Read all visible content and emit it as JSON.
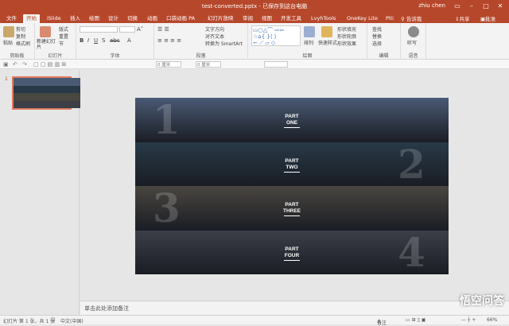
{
  "window": {
    "title": "test-converted.pptx - 已保存到这台电脑",
    "user": "zhiu chen"
  },
  "tabs": [
    "文件",
    "开始",
    "iSlide",
    "插入",
    "绘图",
    "设计",
    "切换",
    "动画",
    "口袋动画 PA",
    "幻灯片放映",
    "审阅",
    "视图",
    "开发工具",
    "LvyhTools",
    "OneKey Lite",
    "Piti"
  ],
  "tabs_right": {
    "search": "告诉我",
    "share": "共享",
    "approve": "批准"
  },
  "ribbon": {
    "clipboard": {
      "label": "剪贴板",
      "paste": "粘贴",
      "cut": "剪切",
      "copy": "复制",
      "format": "格式刷"
    },
    "slides": {
      "label": "幻灯片",
      "new_slide": "新建幻灯片",
      "layout": "版式",
      "reset": "重置",
      "section": "节"
    },
    "font": {
      "label": "字体"
    },
    "paragraph": {
      "label": "段落",
      "text_direction": "文字方向",
      "align_text": "对齐文本",
      "smartart": "转换为 SmartArt"
    },
    "drawing": {
      "label": "绘图",
      "arrange": "排列",
      "quick_styles": "快速样式",
      "fill": "形状填充",
      "outline": "形状轮廓",
      "effect": "形状效果"
    },
    "editing": {
      "label": "编辑",
      "find": "查找",
      "replace": "替换",
      "select": "选择"
    },
    "voice": {
      "label": "语音",
      "dictate": "听写"
    }
  },
  "qat": {
    "field1": "0 厘米",
    "field2": "0 厘米"
  },
  "thumbnail": {
    "number": "1"
  },
  "slide": {
    "bands": [
      {
        "number": "1",
        "part": "PART",
        "name": "ONE",
        "bg": "#4a5a74"
      },
      {
        "number": "2",
        "part": "PART",
        "name": "TWO",
        "bg": "#283a48"
      },
      {
        "number": "3",
        "part": "PART",
        "name": "THREE",
        "bg": "#4a4640"
      },
      {
        "number": "4",
        "part": "PART",
        "name": "FOUR",
        "bg": "#3c3f48"
      }
    ]
  },
  "notes": {
    "placeholder": "单击此处添加备注"
  },
  "status": {
    "slide_info": "幻灯片 第 1 张，共 1 张",
    "language": "中文(中国)",
    "notes": "备注",
    "zoom": "66%"
  },
  "watermark": {
    "text": "悟空问答"
  },
  "colors": {
    "accent": "#b7472a"
  }
}
